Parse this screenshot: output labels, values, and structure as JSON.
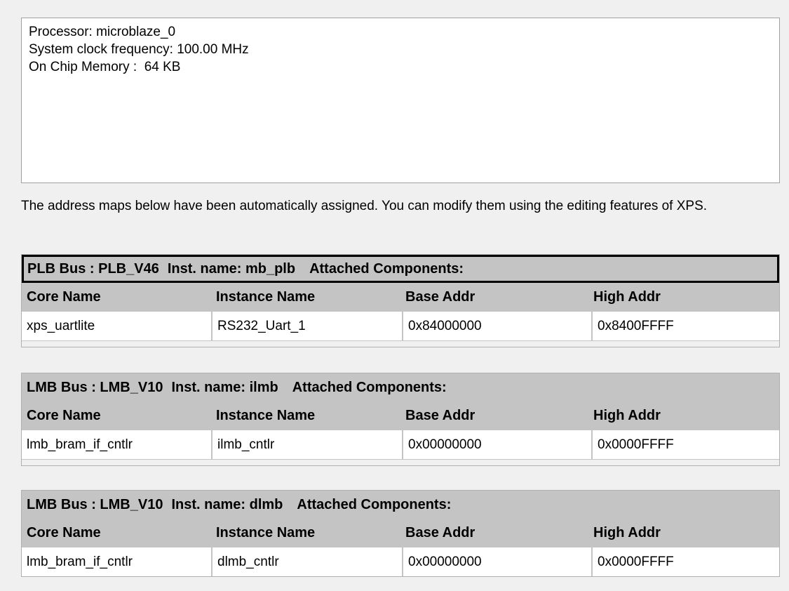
{
  "summary": {
    "processor": "Processor: microblaze_0",
    "clock": "System clock frequency: 100.00 MHz",
    "memory": "On Chip Memory :  64 KB"
  },
  "note": "The address maps below have been automatically assigned.  You can modify them using the editing features of XPS.",
  "columns": {
    "core": "Core Name",
    "instance": "Instance Name",
    "base": "Base Addr",
    "high": "High Addr"
  },
  "buses": [
    {
      "bus": "PLB Bus : PLB_V46",
      "inst": "Inst. name: mb_plb",
      "attached": "Attached Components:",
      "rows": [
        {
          "core": "xps_uartlite",
          "instance": "RS232_Uart_1",
          "base": "0x84000000",
          "high": "0x8400FFFF"
        }
      ]
    },
    {
      "bus": "LMB Bus : LMB_V10",
      "inst": "Inst. name: ilmb",
      "attached": "Attached Components:",
      "rows": [
        {
          "core": "lmb_bram_if_cntlr",
          "instance": "ilmb_cntlr",
          "base": "0x00000000",
          "high": "0x0000FFFF"
        }
      ]
    },
    {
      "bus": "LMB Bus : LMB_V10",
      "inst": "Inst. name: dlmb",
      "attached": "Attached Components:",
      "rows": [
        {
          "core": "lmb_bram_if_cntlr",
          "instance": "dlmb_cntlr",
          "base": "0x00000000",
          "high": "0x0000FFFF"
        }
      ]
    }
  ]
}
